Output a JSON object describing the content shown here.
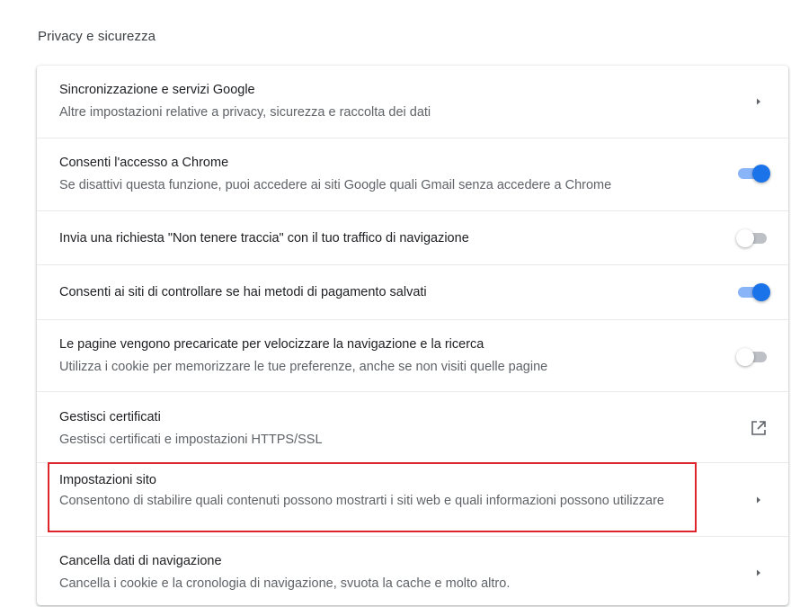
{
  "section": {
    "title": "Privacy e sicurezza"
  },
  "rows": [
    {
      "title": "Sincronizzazione e servizi Google",
      "subtitle": "Altre impostazioni relative a privacy, sicurezza e raccolta dei dati",
      "control": "arrow"
    },
    {
      "title": "Consenti l'accesso a Chrome",
      "subtitle": "Se disattivi questa funzione, puoi accedere ai siti Google quali Gmail senza accedere a Chrome",
      "control": "toggle",
      "enabled": true
    },
    {
      "title": "Invia una richiesta \"Non tenere traccia\" con il tuo traffico di navigazione",
      "control": "toggle",
      "enabled": false
    },
    {
      "title": "Consenti ai siti di controllare se hai metodi di pagamento salvati",
      "control": "toggle",
      "enabled": true
    },
    {
      "title": "Le pagine vengono precaricate per velocizzare la navigazione e la ricerca",
      "subtitle": "Utilizza i cookie per memorizzare le tue preferenze, anche se non visiti quelle pagine",
      "control": "toggle",
      "enabled": false
    },
    {
      "title": "Gestisci certificati",
      "subtitle": "Gestisci certificati e impostazioni HTTPS/SSL",
      "control": "external-link-icon"
    },
    {
      "title": "Impostazioni sito",
      "subtitle": "Consentono di stabilire quali contenuti possono mostrarti i siti web e quali informazioni possono utilizzare",
      "control": "arrow",
      "highlighted": true
    },
    {
      "title": "Cancella dati di navigazione",
      "subtitle": "Cancella i cookie e la cronologia di navigazione, svuota la cache e molto altro.",
      "control": "arrow"
    }
  ],
  "colors": {
    "accent": "#1a73e8",
    "highlight_border": "#e0242c"
  }
}
